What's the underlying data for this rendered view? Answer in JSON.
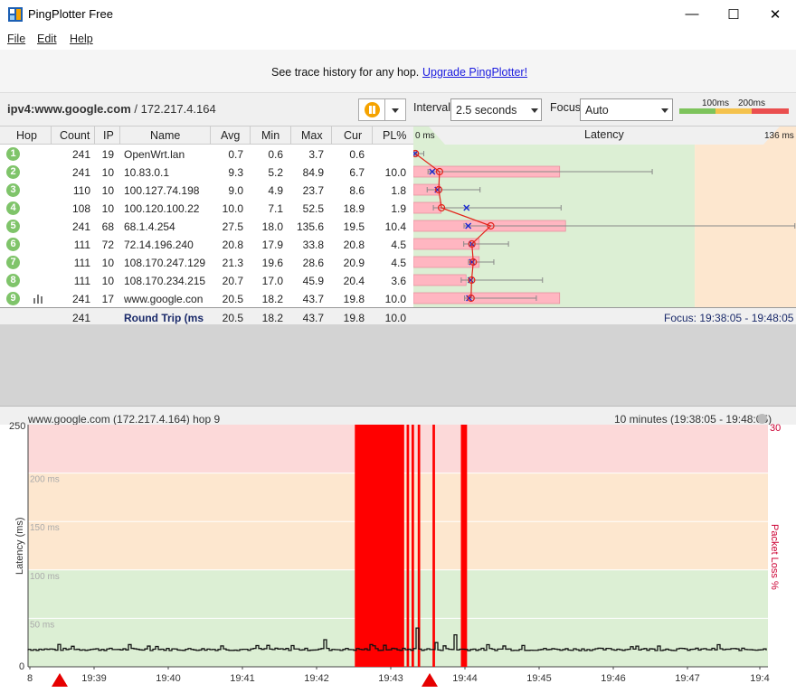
{
  "window": {
    "title": "PingPlotter Free",
    "minimize_glyph": "—",
    "maximize_glyph": "☐",
    "close_glyph": "✕"
  },
  "menu": [
    "File",
    "Edit",
    "Help"
  ],
  "banner": {
    "text": "See trace history for any hop.",
    "link": "Upgrade PingPlotter!"
  },
  "toolbar": {
    "target_bold": "ipv4:www.google.com",
    "target_rest": " / 172.217.4.164",
    "interval_label": "Interval",
    "interval_value": "2.5 seconds",
    "focus_label": "Focus",
    "focus_value": "Auto",
    "scale_100": "100ms",
    "scale_200": "200ms",
    "scale_colors": [
      "#7dc35b",
      "#f4c24d",
      "#ea4f4f"
    ]
  },
  "table": {
    "headers": [
      "Hop",
      "Count",
      "IP",
      "Name",
      "Avg",
      "Min",
      "Max",
      "Cur",
      "PL%"
    ],
    "latency_header": "Latency",
    "latency_min": "0 ms",
    "latency_max": "136 ms",
    "rows": [
      {
        "hop": "1",
        "count": "241",
        "ip": "19",
        "name": "OpenWrt.lan",
        "avg": "0.7",
        "min": "0.6",
        "max": "3.7",
        "cur": "0.6",
        "pl": ""
      },
      {
        "hop": "2",
        "count": "241",
        "ip": "10",
        "name": "10.83.0.1",
        "avg": "9.3",
        "min": "5.2",
        "max": "84.9",
        "cur": "6.7",
        "pl": "10.0"
      },
      {
        "hop": "3",
        "count": "110",
        "ip": "10",
        "name": "100.127.74.198",
        "avg": "9.0",
        "min": "4.9",
        "max": "23.7",
        "cur": "8.6",
        "pl": "1.8"
      },
      {
        "hop": "4",
        "count": "108",
        "ip": "10",
        "name": "100.120.100.22",
        "avg": "10.0",
        "min": "7.1",
        "max": "52.5",
        "cur": "18.9",
        "pl": "1.9"
      },
      {
        "hop": "5",
        "count": "241",
        "ip": "68",
        "name": "68.1.4.254",
        "avg": "27.5",
        "min": "18.0",
        "max": "135.6",
        "cur": "19.5",
        "pl": "10.4"
      },
      {
        "hop": "6",
        "count": "111",
        "ip": "72",
        "name": "72.14.196.240",
        "avg": "20.8",
        "min": "17.9",
        "max": "33.8",
        "cur": "20.8",
        "pl": "4.5"
      },
      {
        "hop": "7",
        "count": "111",
        "ip": "10",
        "name": "108.170.247.129",
        "avg": "21.3",
        "min": "19.6",
        "max": "28.6",
        "cur": "20.9",
        "pl": "4.5"
      },
      {
        "hop": "8",
        "count": "111",
        "ip": "10",
        "name": "108.170.234.215",
        "avg": "20.7",
        "min": "17.0",
        "max": "45.9",
        "cur": "20.4",
        "pl": "3.6"
      },
      {
        "hop": "9",
        "count": "241",
        "ip": "17",
        "name": "www.google.con",
        "avg": "20.5",
        "min": "18.2",
        "max": "43.7",
        "cur": "19.8",
        "pl": "10.0"
      }
    ],
    "summary": {
      "count": "241",
      "name": "Round Trip (ms)",
      "avg": "20.5",
      "min": "18.2",
      "max": "43.7",
      "cur": "19.8",
      "pl": "10.0",
      "focus": "Focus: 19:38:05 - 19:48:05"
    }
  },
  "graph": {
    "title": "www.google.com (172.217.4.164) hop 9",
    "range": "10 minutes (19:38:05 - 19:48:05)",
    "y_label": "Latency (ms)",
    "y2_label": "Packet Loss %",
    "y_top": "250",
    "y_zero": "0",
    "y2_top": "30",
    "bands": [
      "200 ms",
      "150 ms",
      "100 ms",
      "50 ms"
    ],
    "x_labels": [
      "8",
      "19:39",
      "19:40",
      "19:41",
      "19:42",
      "19:43",
      "19:44",
      "19:45",
      "19:46",
      "19:47",
      "19:4"
    ]
  },
  "chart_data": {
    "type": "line",
    "title": "www.google.com (172.217.4.164) hop 9",
    "ylabel": "Latency (ms)",
    "y2label": "Packet Loss %",
    "ylim": [
      0,
      250
    ],
    "y2lim": [
      0,
      30
    ],
    "x_ticks": [
      "19:39",
      "19:40",
      "19:41",
      "19:42",
      "19:43",
      "19:44",
      "19:45",
      "19:46",
      "19:47"
    ],
    "baseline_ms": 18,
    "spikes": [
      {
        "t": "19:42:05",
        "ms": 28
      },
      {
        "t": "19:43:20",
        "ms": 40
      },
      {
        "t": "19:43:35",
        "ms": 25
      },
      {
        "t": "19:43:50",
        "ms": 33
      }
    ],
    "packet_loss_windows": [
      {
        "start": "19:42:30",
        "end": "19:43:10"
      },
      {
        "start": "19:43:12",
        "end": "19:43:14"
      },
      {
        "start": "19:43:16",
        "end": "19:43:18"
      },
      {
        "start": "19:43:21",
        "end": "19:43:23"
      },
      {
        "start": "19:43:33",
        "end": "19:43:35"
      },
      {
        "start": "19:43:56",
        "end": "19:44:01"
      }
    ]
  }
}
